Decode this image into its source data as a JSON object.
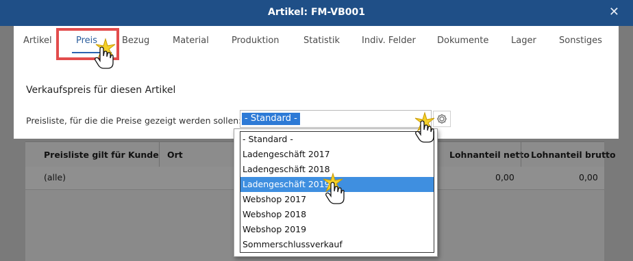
{
  "window": {
    "title": "Artikel: FM-VB001",
    "close_glyph": "✕"
  },
  "tabs": [
    {
      "label": "Artikel",
      "active": false
    },
    {
      "label": "Preis",
      "active": true
    },
    {
      "label": "Bezug",
      "active": false
    },
    {
      "label": "Material",
      "active": false
    },
    {
      "label": "Produktion",
      "active": false
    },
    {
      "label": "Statistik",
      "active": false
    },
    {
      "label": "Indiv. Felder",
      "active": false
    },
    {
      "label": "Dokumente",
      "active": false
    },
    {
      "label": "Lager",
      "active": false
    },
    {
      "label": "Sonstiges",
      "active": false
    }
  ],
  "section": {
    "title": "Verkaufspreis für diesen Artikel"
  },
  "pricelist": {
    "label": "Preisliste, für die die Preise gezeigt werden sollen:",
    "selected_value": "- Standard -",
    "options": [
      "- Standard -",
      "Ladengeschäft 2017",
      "Ladengeschäft 2018",
      "Ladengeschäft 2019",
      "Webshop 2017",
      "Webshop 2018",
      "Webshop 2019",
      "Sommerschlussverkauf"
    ],
    "highlighted_option": "Ladengeschäft 2019"
  },
  "grid": {
    "columns": [
      "Preisliste gilt für Kunde",
      "Ort",
      "Lohnanteil netto",
      "Lohnanteil brutto"
    ],
    "rows": [
      {
        "kunde": "(alle)",
        "ort": "",
        "lohn_netto": "0,00",
        "lohn_brutto": "0,00"
      }
    ]
  },
  "colors": {
    "titlebar": "#1f4f87",
    "accent": "#2a63b0",
    "selection": "#3f8fe0",
    "highlight_box": "#e24c4c",
    "overlay": "#7a7a7a"
  }
}
